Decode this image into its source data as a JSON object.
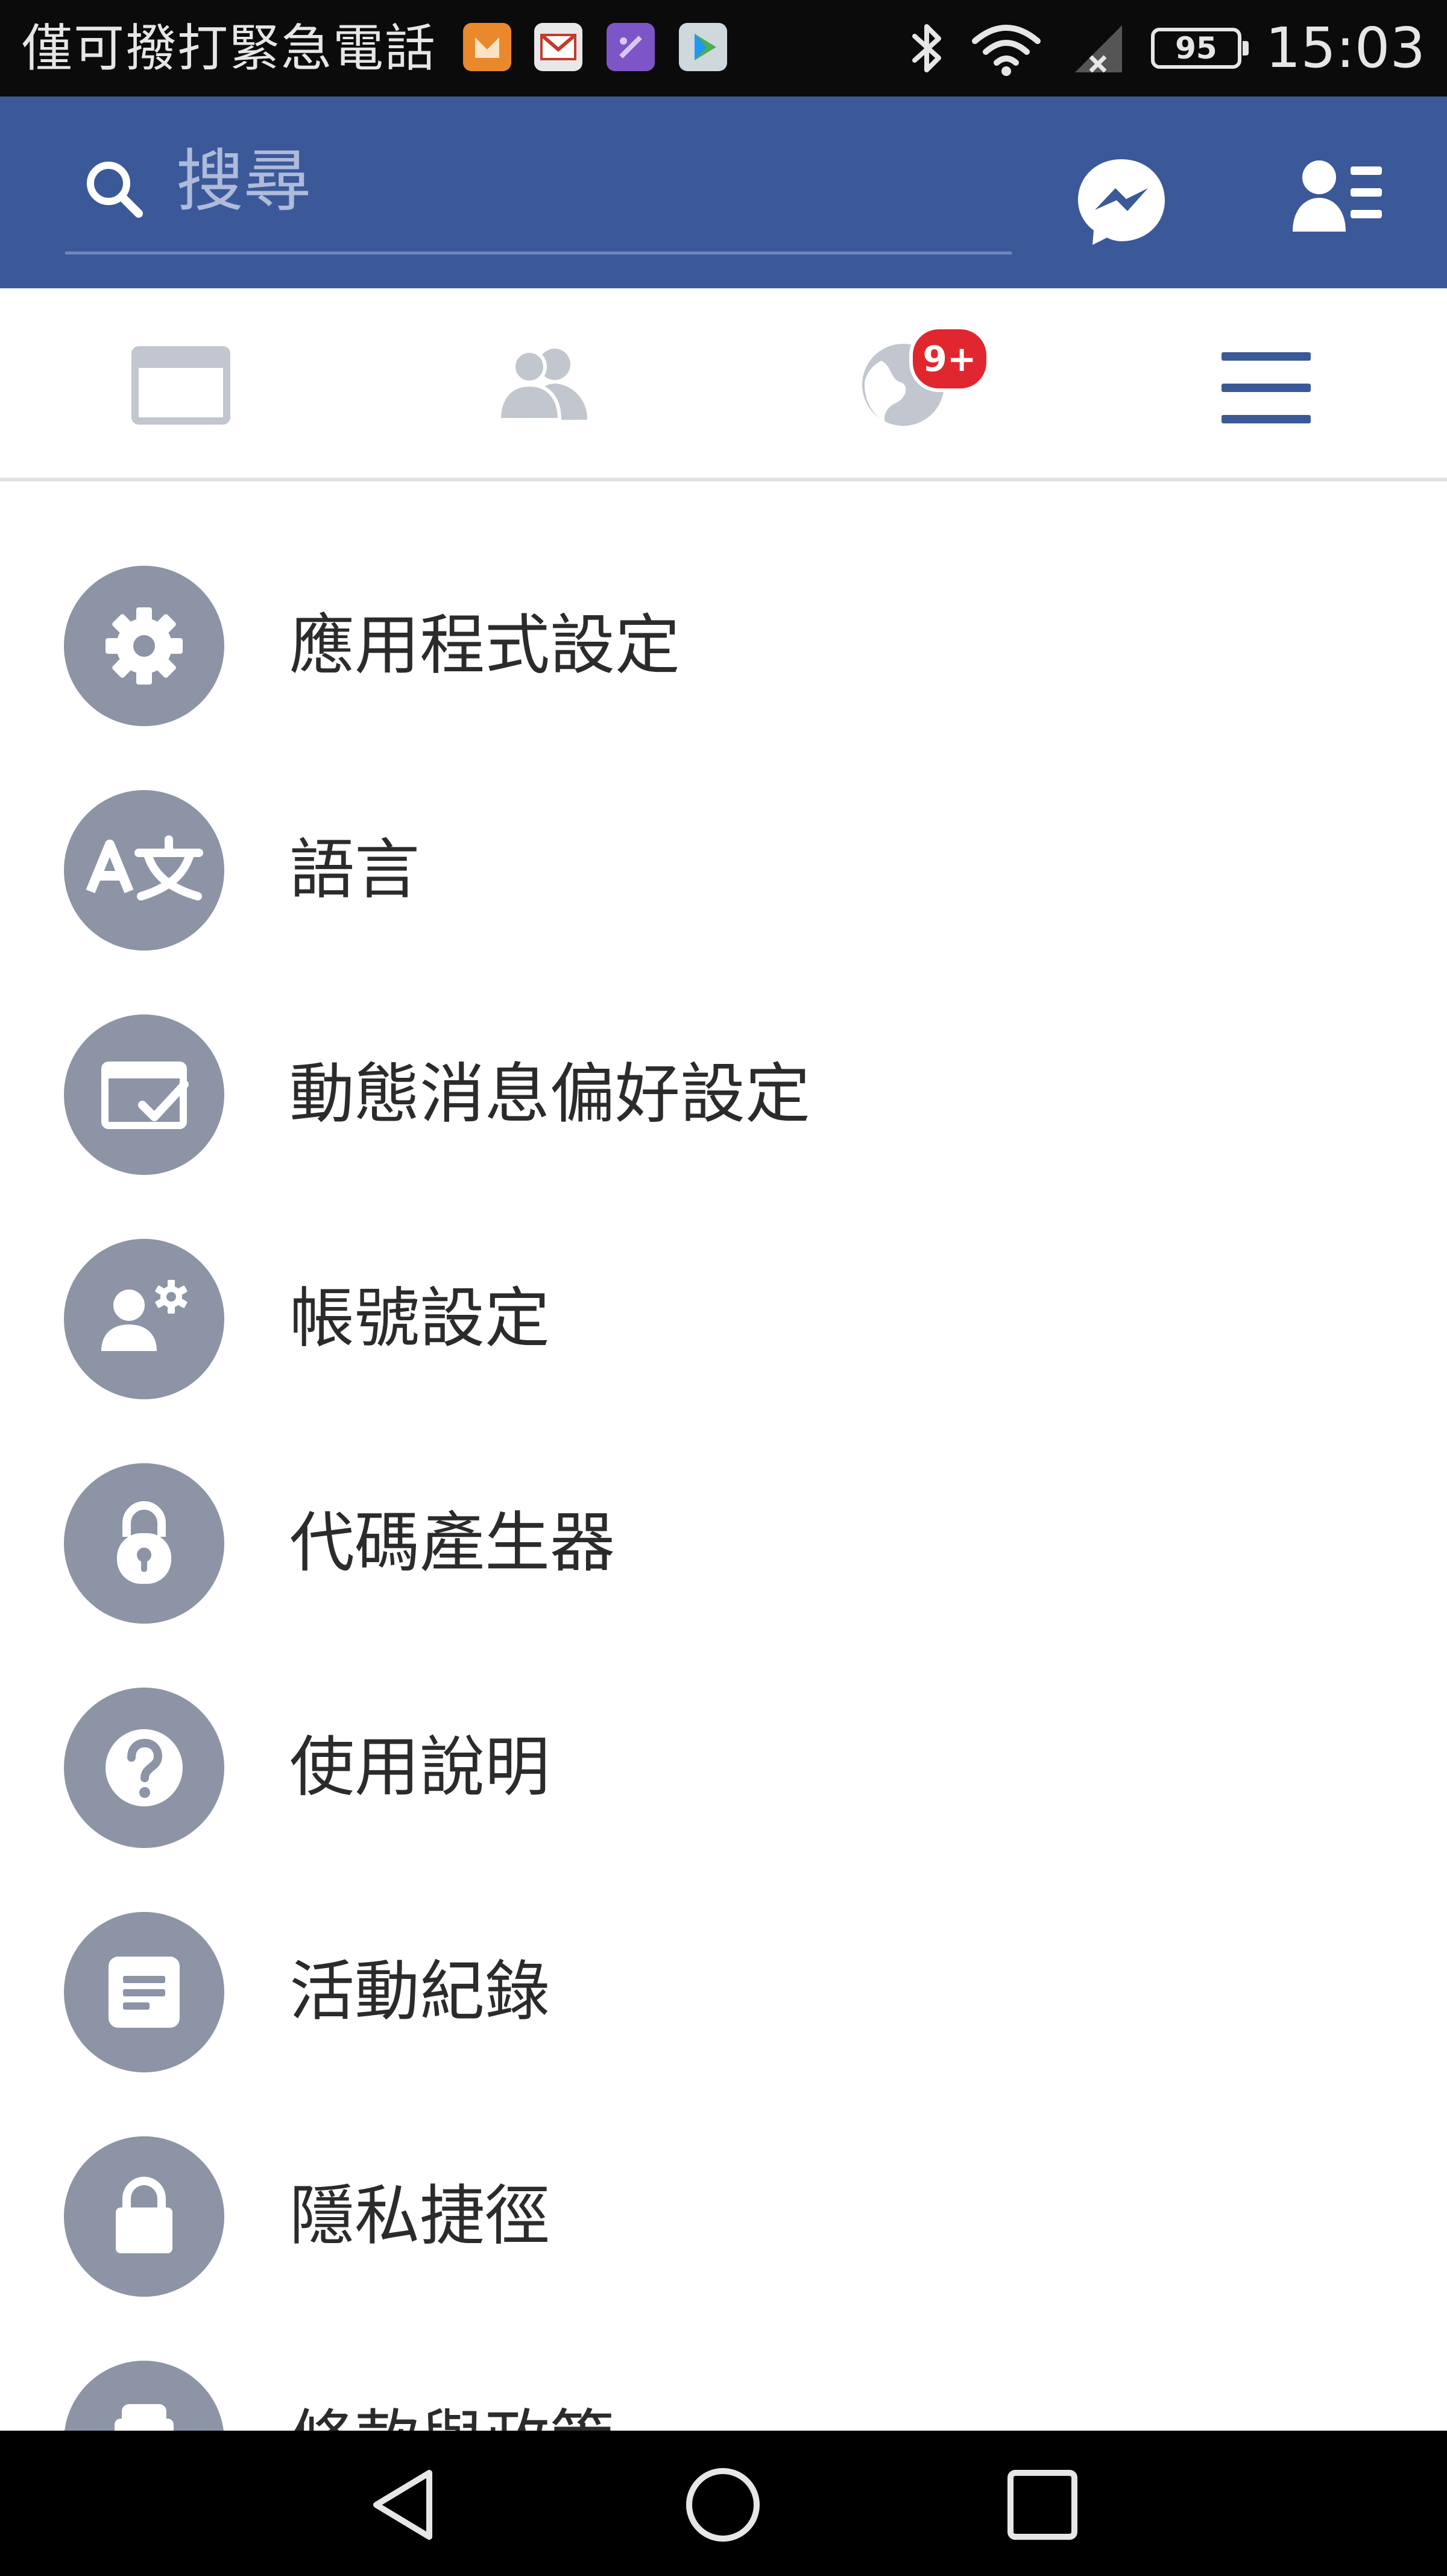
{
  "status_bar": {
    "carrier_text": "僅可撥打緊急電話",
    "battery_level": "95",
    "time": "15:03",
    "notification_icons": [
      "orange-app-icon",
      "gmail-icon",
      "purple-app-icon",
      "play-store-icon"
    ]
  },
  "header": {
    "search_placeholder": "搜尋",
    "brand_color": "#3b5998"
  },
  "tabs": {
    "notifications_badge": "9+",
    "items": [
      "news-feed-icon",
      "friend-requests-icon",
      "notifications-globe-icon",
      "menu-icon"
    ],
    "active": "menu-icon"
  },
  "menu": {
    "items": [
      {
        "label": "應用程式設定",
        "icon": "gear-icon"
      },
      {
        "label": "語言",
        "icon": "translate-icon"
      },
      {
        "label": "動態消息偏好設定",
        "icon": "feed-preferences-icon"
      },
      {
        "label": "帳號設定",
        "icon": "account-settings-icon"
      },
      {
        "label": "代碼產生器",
        "icon": "code-generator-lock-icon"
      },
      {
        "label": "使用說明",
        "icon": "help-question-icon"
      },
      {
        "label": "活動紀錄",
        "icon": "activity-log-icon"
      },
      {
        "label": "隱私捷徑",
        "icon": "privacy-lock-icon"
      },
      {
        "label": "條款與政策",
        "icon": "policy-icon"
      }
    ]
  },
  "nav_bar": {
    "buttons": [
      "back-icon",
      "home-icon",
      "recents-icon"
    ]
  }
}
